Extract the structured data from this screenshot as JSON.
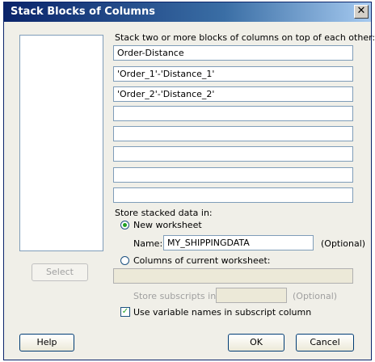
{
  "window": {
    "title": "Stack Blocks of Columns",
    "close_symbol": "✕"
  },
  "instructions": "Stack two or more blocks of columns on top of each other:",
  "blocks": [
    "Order-Distance",
    "'Order_1'-'Distance_1'",
    "'Order_2'-'Distance_2'",
    "",
    "",
    "",
    "",
    ""
  ],
  "store": {
    "label": "Store stacked data in:",
    "new_worksheet_label": "New worksheet",
    "name_label": "Name:",
    "name_value": "MY_SHIPPINGDATA",
    "optional_label": "(Optional)",
    "columns_label": "Columns of current worksheet:",
    "columns_value": "",
    "subscripts_label": "Store subscripts in:",
    "subscripts_value": "",
    "subscripts_optional": "(Optional)",
    "use_names_label": "Use variable names in subscript column"
  },
  "buttons": {
    "select": "Select",
    "help": "Help",
    "ok": "OK",
    "cancel": "Cancel"
  }
}
